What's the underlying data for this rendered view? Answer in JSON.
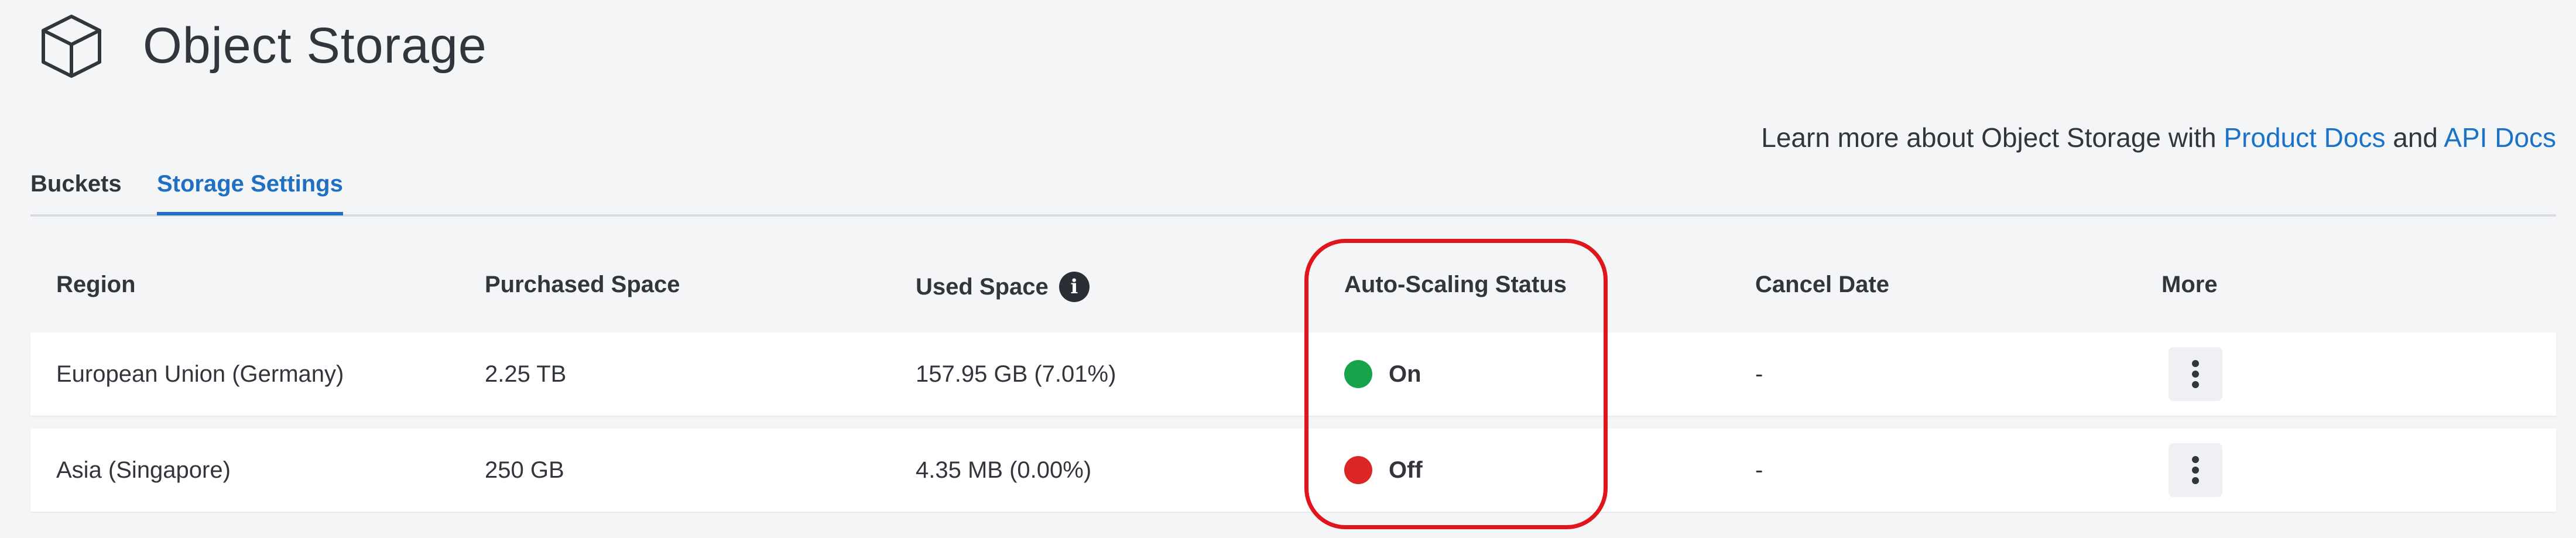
{
  "header": {
    "title": "Object Storage",
    "icon": "cube-icon"
  },
  "docs": {
    "prefix": "Learn more about Object Storage with ",
    "product_docs": "Product Docs",
    "and": " and ",
    "api_docs": "API Docs"
  },
  "tabs": [
    {
      "label": "Buckets",
      "active": false
    },
    {
      "label": "Storage Settings",
      "active": true
    }
  ],
  "table": {
    "columns": [
      "Region",
      "Purchased Space",
      "Used Space",
      "Auto-Scaling Status",
      "Cancel Date",
      "More"
    ],
    "rows": [
      {
        "region": "European Union (Germany)",
        "purchased": "2.25 TB",
        "used": "157.95 GB (7.01%)",
        "status": "On",
        "status_color": "#16a34a",
        "cancel": "-"
      },
      {
        "region": "Asia (Singapore)",
        "purchased": "250 GB",
        "used": "4.35 MB (0.00%)",
        "status": "Off",
        "status_color": "#dc2626",
        "cancel": "-"
      }
    ]
  },
  "colors": {
    "accent": "#1f6fc2",
    "highlight": "#e0161c",
    "on": "#16a34a",
    "off": "#dc2626"
  }
}
